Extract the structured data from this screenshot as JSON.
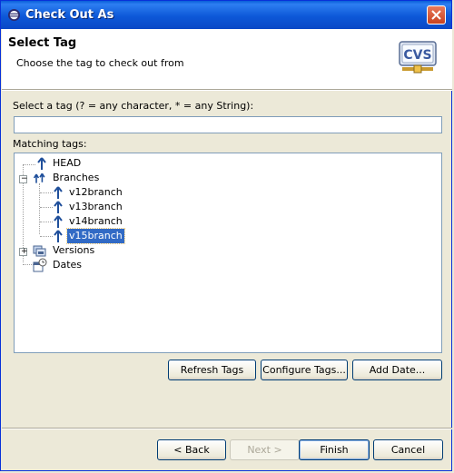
{
  "window": {
    "title": "Check Out As",
    "close_icon": "close-icon"
  },
  "header": {
    "title": "Select Tag",
    "description": "Choose the tag to check out from",
    "logo_text": "CVS"
  },
  "filter": {
    "label": "Select a tag (? = any character, * = any String):",
    "value": ""
  },
  "tree": {
    "label": "Matching tags:",
    "items": {
      "head": "HEAD",
      "branches": "Branches",
      "v12": "v12branch",
      "v13": "v13branch",
      "v14": "v14branch",
      "v15": "v15branch",
      "versions": "Versions",
      "dates": "Dates"
    },
    "selected": "v15branch"
  },
  "actions": {
    "refresh": "Refresh Tags",
    "configure": "Configure Tags...",
    "add_date": "Add Date..."
  },
  "footer": {
    "back": "< Back",
    "next": "Next >",
    "finish": "Finish",
    "cancel": "Cancel"
  }
}
